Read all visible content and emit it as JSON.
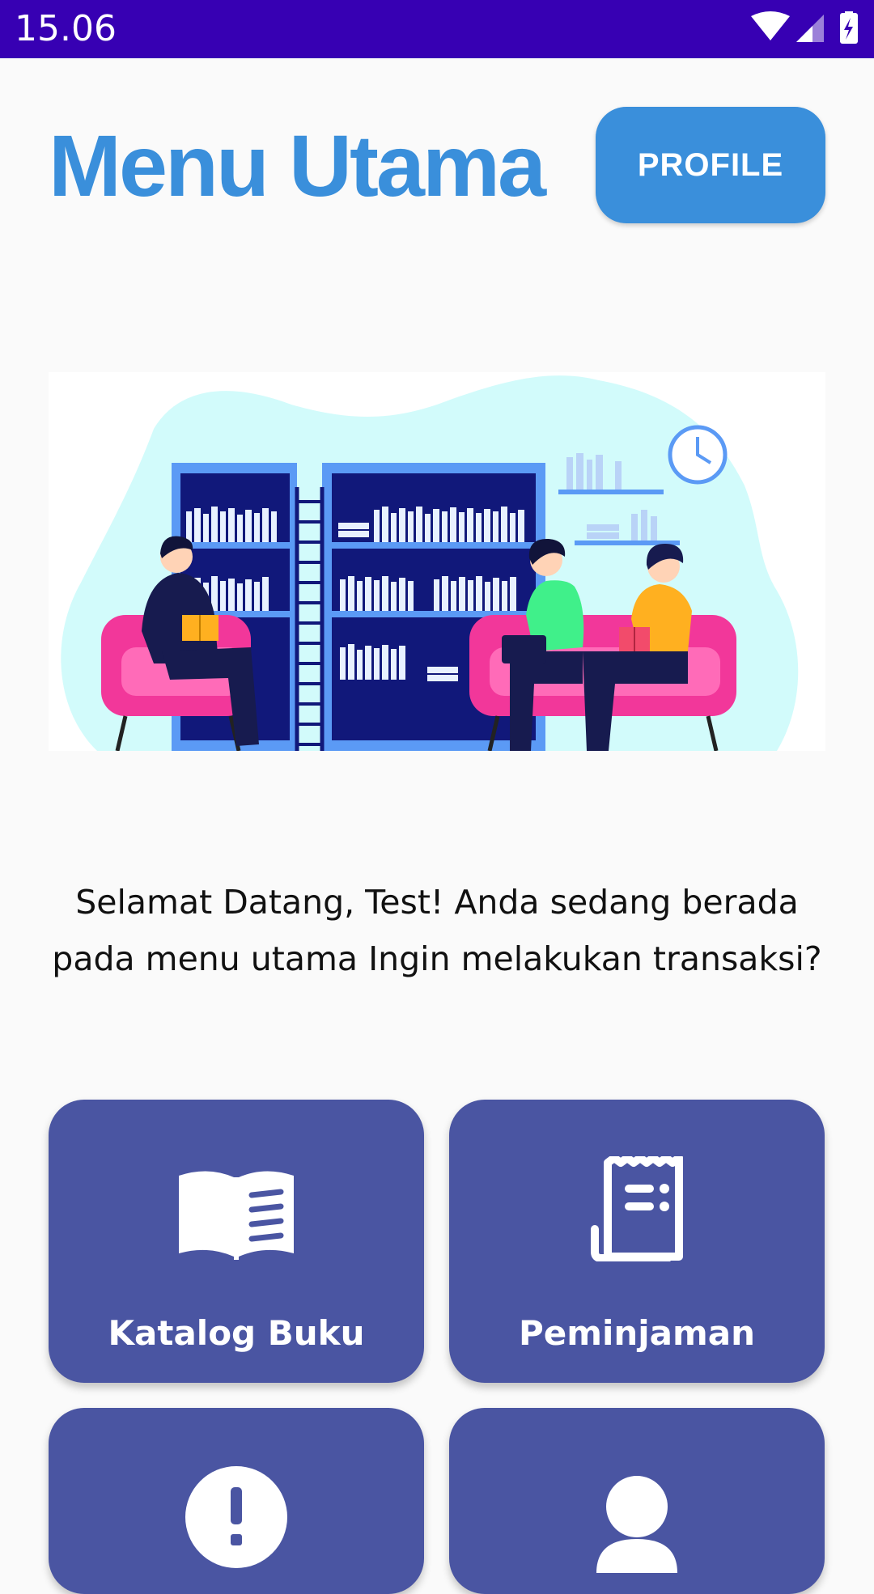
{
  "status_bar": {
    "time": "15.06"
  },
  "header": {
    "title": "Menu Utama",
    "profile_label": "PROFILE"
  },
  "welcome_message": "Selamat Datang, Test! Anda sedang berada pada menu utama Ingin melakukan transaksi?",
  "menu": {
    "tiles": [
      {
        "label": "Katalog Buku",
        "icon": "book-icon"
      },
      {
        "label": "Peminjaman",
        "icon": "receipt-icon"
      },
      {
        "label": "",
        "icon": "alert-icon"
      },
      {
        "label": "",
        "icon": "person-icon"
      }
    ]
  },
  "colors": {
    "status_bar": "#3700b3",
    "accent": "#3a8fdb",
    "tile": "#4a55a2",
    "background": "#fafafa"
  }
}
